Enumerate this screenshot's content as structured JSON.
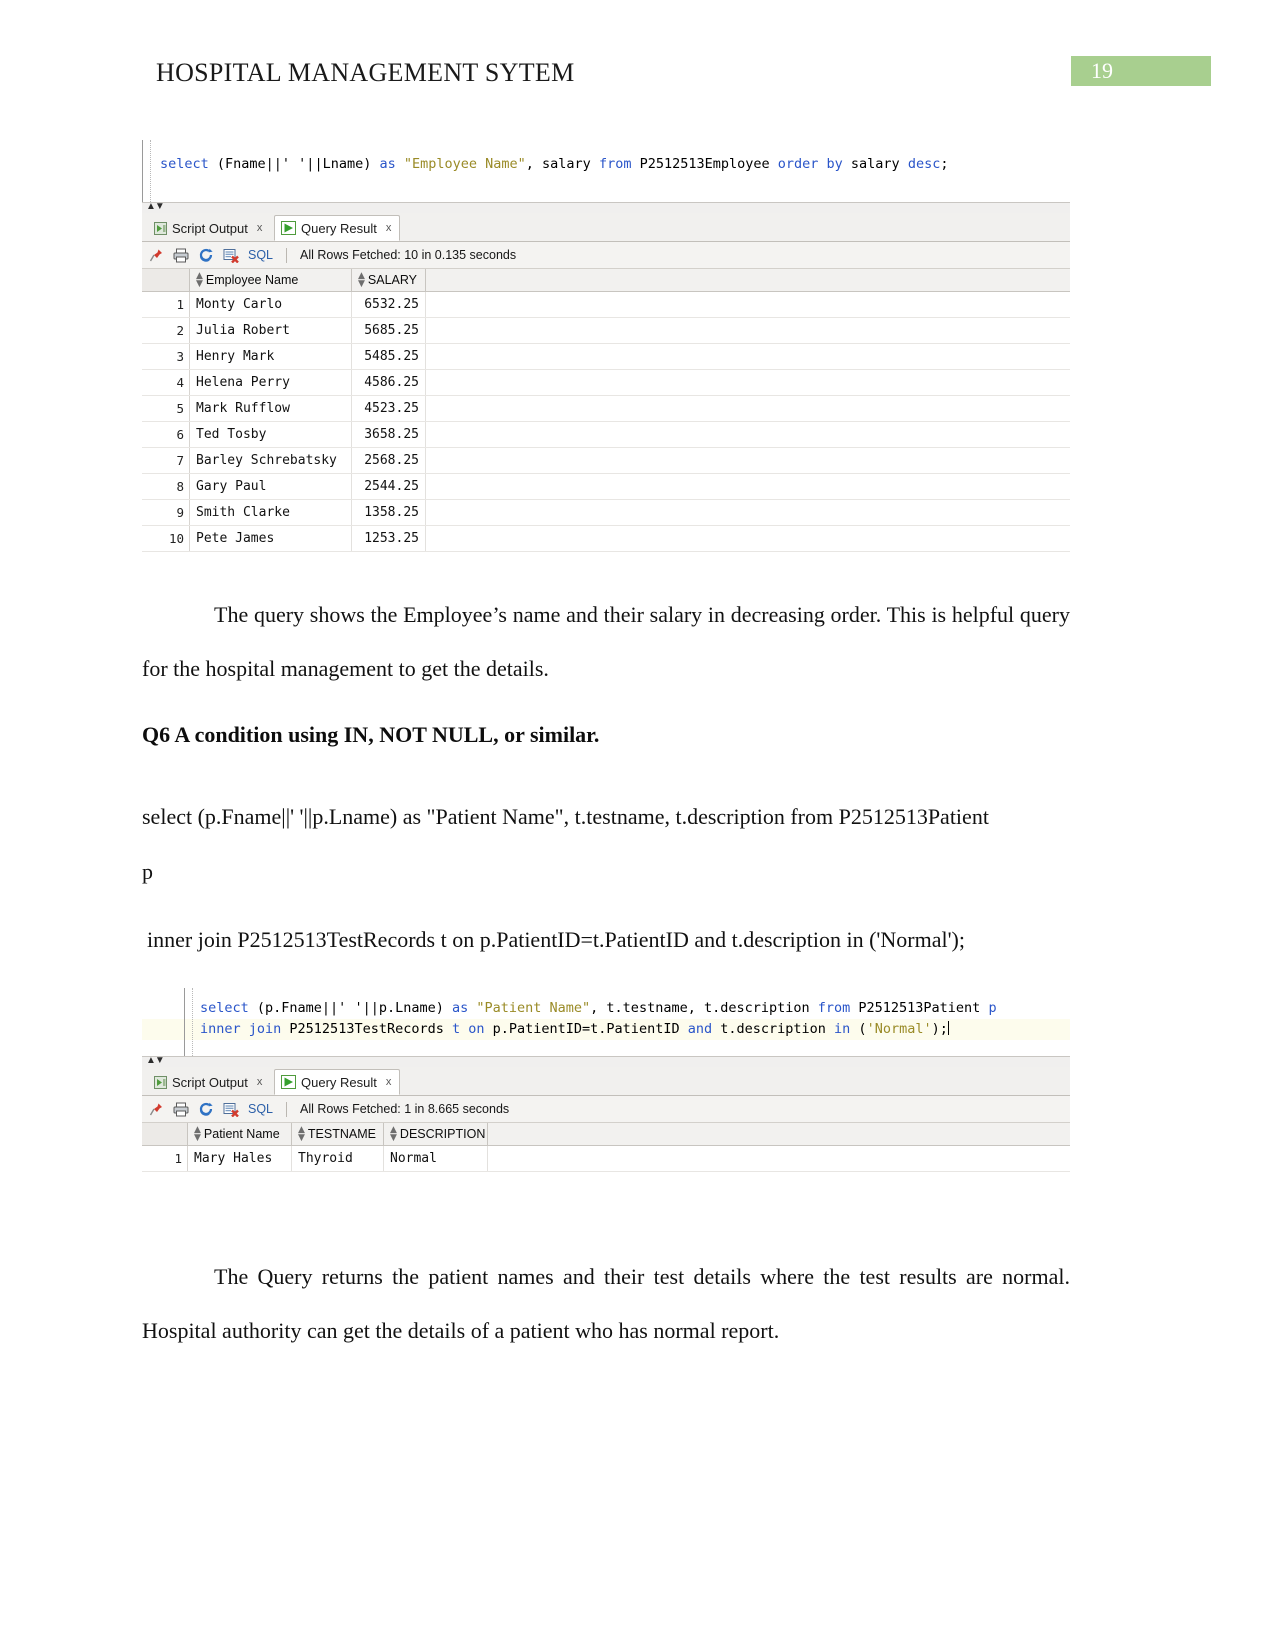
{
  "header": {
    "title": "HOSPITAL MANAGEMENT SYTEM",
    "page_number": "19",
    "badge_color": "#a8cf8f"
  },
  "panel1": {
    "code_lines": [
      {
        "tokens": [
          {
            "t": "select ",
            "c": "kw"
          },
          {
            "t": "(Fname||' '||Lname) ",
            "c": "plain"
          },
          {
            "t": "as ",
            "c": "kw"
          },
          {
            "t": "\"Employee Name\"",
            "c": "str"
          },
          {
            "t": ", salary ",
            "c": "plain"
          },
          {
            "t": "from ",
            "c": "kw"
          },
          {
            "t": "P2512513Employee ",
            "c": "plain"
          },
          {
            "t": "order by ",
            "c": "kw"
          },
          {
            "t": "salary ",
            "c": "plain"
          },
          {
            "t": "desc",
            "c": "kw"
          },
          {
            "t": ";",
            "c": "plain"
          }
        ]
      }
    ],
    "tabs": [
      {
        "label": "Script Output",
        "icon": "script-output-icon",
        "active": false,
        "close": "x"
      },
      {
        "label": "Query Result",
        "icon": "play-icon",
        "active": true,
        "close": "x"
      }
    ],
    "toolbar": {
      "icons": [
        "pin-icon",
        "print-icon",
        "refresh-icon",
        "detach-icon"
      ],
      "sql_label": "SQL",
      "status": "All Rows Fetched: 10 in 0.135 seconds"
    },
    "grid": {
      "columns": [
        "Employee Name",
        "SALARY"
      ],
      "rows": [
        {
          "n": "1",
          "name": "Monty Carlo",
          "salary": "6532.25"
        },
        {
          "n": "2",
          "name": "Julia Robert",
          "salary": "5685.25"
        },
        {
          "n": "3",
          "name": "Henry Mark",
          "salary": "5485.25"
        },
        {
          "n": "4",
          "name": "Helena Perry",
          "salary": "4586.25"
        },
        {
          "n": "5",
          "name": "Mark Rufflow",
          "salary": "4523.25"
        },
        {
          "n": "6",
          "name": "Ted Tosby",
          "salary": "3658.25"
        },
        {
          "n": "7",
          "name": "Barley Schrebatsky",
          "salary": "2568.25"
        },
        {
          "n": "8",
          "name": "Gary Paul",
          "salary": "2544.25"
        },
        {
          "n": "9",
          "name": "Smith Clarke",
          "salary": "1358.25"
        },
        {
          "n": "10",
          "name": "Pete James",
          "salary": "1253.25"
        }
      ]
    }
  },
  "paragraph1": "The query shows the Employee’s name and their salary in decreasing order. This is helpful query for the hospital management to get the details.",
  "q6_heading": "Q6 A condition using IN, NOT NULL, or similar.",
  "q6_query_line1": "select (p.Fname||' '||p.Lname) as \"Patient Name\", t.testname, t.description from P2512513Patient",
  "q6_query_line2": "p",
  "q6_query_line3": "inner join P2512513TestRecords t on p.PatientID=t.PatientID and t.description in ('Normal');",
  "panel2": {
    "code_lines": [
      {
        "tokens": [
          {
            "t": "select ",
            "c": "kw"
          },
          {
            "t": "(p.Fname||' '||p.Lname) ",
            "c": "plain"
          },
          {
            "t": "as ",
            "c": "kw"
          },
          {
            "t": "\"Patient Name\"",
            "c": "str"
          },
          {
            "t": ", t.testname, t.description ",
            "c": "plain"
          },
          {
            "t": "from ",
            "c": "kw"
          },
          {
            "t": "P2512513Patient ",
            "c": "plain"
          },
          {
            "t": "p",
            "c": "kw"
          }
        ]
      },
      {
        "tokens": [
          {
            "t": "inner ",
            "c": "kw"
          },
          {
            "t": "join ",
            "c": "kw"
          },
          {
            "t": "P2512513TestRecords ",
            "c": "plain"
          },
          {
            "t": "t ",
            "c": "kw"
          },
          {
            "t": "on ",
            "c": "kw"
          },
          {
            "t": "p.PatientID=t.PatientID ",
            "c": "plain"
          },
          {
            "t": "and ",
            "c": "kw"
          },
          {
            "t": "t.description ",
            "c": "plain"
          },
          {
            "t": "in ",
            "c": "kw"
          },
          {
            "t": "(",
            "c": "plain"
          },
          {
            "t": "'Normal'",
            "c": "str"
          },
          {
            "t": ");",
            "c": "plain"
          }
        ]
      }
    ],
    "tabs": [
      {
        "label": "Script Output",
        "icon": "script-output-icon",
        "active": false,
        "close": "x"
      },
      {
        "label": "Query Result",
        "icon": "play-icon",
        "active": true,
        "close": "x"
      }
    ],
    "toolbar": {
      "icons": [
        "pin-icon",
        "print-icon",
        "refresh-icon",
        "detach-icon"
      ],
      "sql_label": "SQL",
      "status": "All Rows Fetched: 1 in 8.665 seconds"
    },
    "grid": {
      "columns": [
        "Patient Name",
        "TESTNAME",
        "DESCRIPTION"
      ],
      "rows": [
        {
          "n": "1",
          "patient": "Mary Hales",
          "testname": "Thyroid",
          "description": "Normal"
        }
      ]
    }
  },
  "paragraph2": "The Query returns the patient names and their test details where the test results are normal. Hospital authority can get the details of a patient who has normal report."
}
